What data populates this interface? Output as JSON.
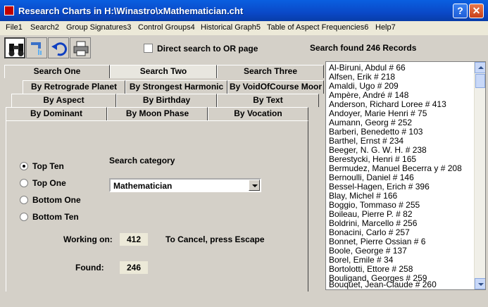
{
  "window": {
    "title": "Research Charts in H:\\Winastro\\xMathematician.cht",
    "help_label": "?",
    "close_label": "✕"
  },
  "menu": [
    "File1",
    "Search2",
    "Group Signatures3",
    "Control Groups4",
    "Historical Graph5",
    "Table of Aspect Frequencies6",
    "Help7"
  ],
  "toolbar": {
    "icons": [
      "binoculars-icon",
      "faucet-icon",
      "undo-arrow-icon",
      "printer-icon"
    ],
    "direct_search_label": "Direct search to OR page",
    "direct_search_checked": false,
    "search_found": "Search found 246 Records"
  },
  "tabs": {
    "row1": [
      "Search One",
      "Search Two",
      "Search Three"
    ],
    "row2": [
      "By Retrograde Planet",
      "By Strongest Harmonic",
      "By VoidOfCourse Moor"
    ],
    "row3": [
      "By Aspect",
      "By Birthday",
      "By Text"
    ],
    "row4": [
      "By Dominant",
      "By Moon Phase",
      "By Vocation"
    ],
    "active": "Search Two"
  },
  "panel": {
    "radios": [
      "Top Ten",
      "Top One",
      "Bottom One",
      "Bottom Ten"
    ],
    "selected_radio": "Top Ten",
    "category_label": "Search category",
    "category_value": "Mathematician",
    "working_label": "Working on:",
    "working_value": "412",
    "cancel_text": "To Cancel, press Escape",
    "found_label": "Found:",
    "found_value": "246"
  },
  "records": [
    "Al-Biruni, Abdul  # 66",
    "Alfsen, Erik  # 218",
    "Amaldi, Ugo  # 209",
    "Ampère, André  # 148",
    "Anderson, Richard Loree  # 413",
    "Andoyer, Marie Henri  # 75",
    "Aumann, Georg  # 252",
    "Barberi, Benedetto  # 103",
    "Barthel, Ernst  # 234",
    "Beeger, N. G. W. H.  # 238",
    "Berestycki, Henri  # 165",
    "Bermudez, Manuel Becerra y  # 208",
    "Bernoulli, Daniel  # 146",
    "Bessel-Hagen, Erich  # 396",
    "Blay, Michel  # 166",
    "Boggio, Tommaso  # 255",
    "Boileau, Pierre P.  # 82",
    "Boldrini, Marcello  # 256",
    "Bonacini, Carlo  # 257",
    "Bonnet, Pierre Ossian  # 6",
    "Boole, George  # 137",
    "Borel, Emile  # 34",
    "Bortolotti, Ettore  # 258",
    "Bouligand, Georges  # 259",
    "Bouquet, Jean-Claude  # 260"
  ]
}
